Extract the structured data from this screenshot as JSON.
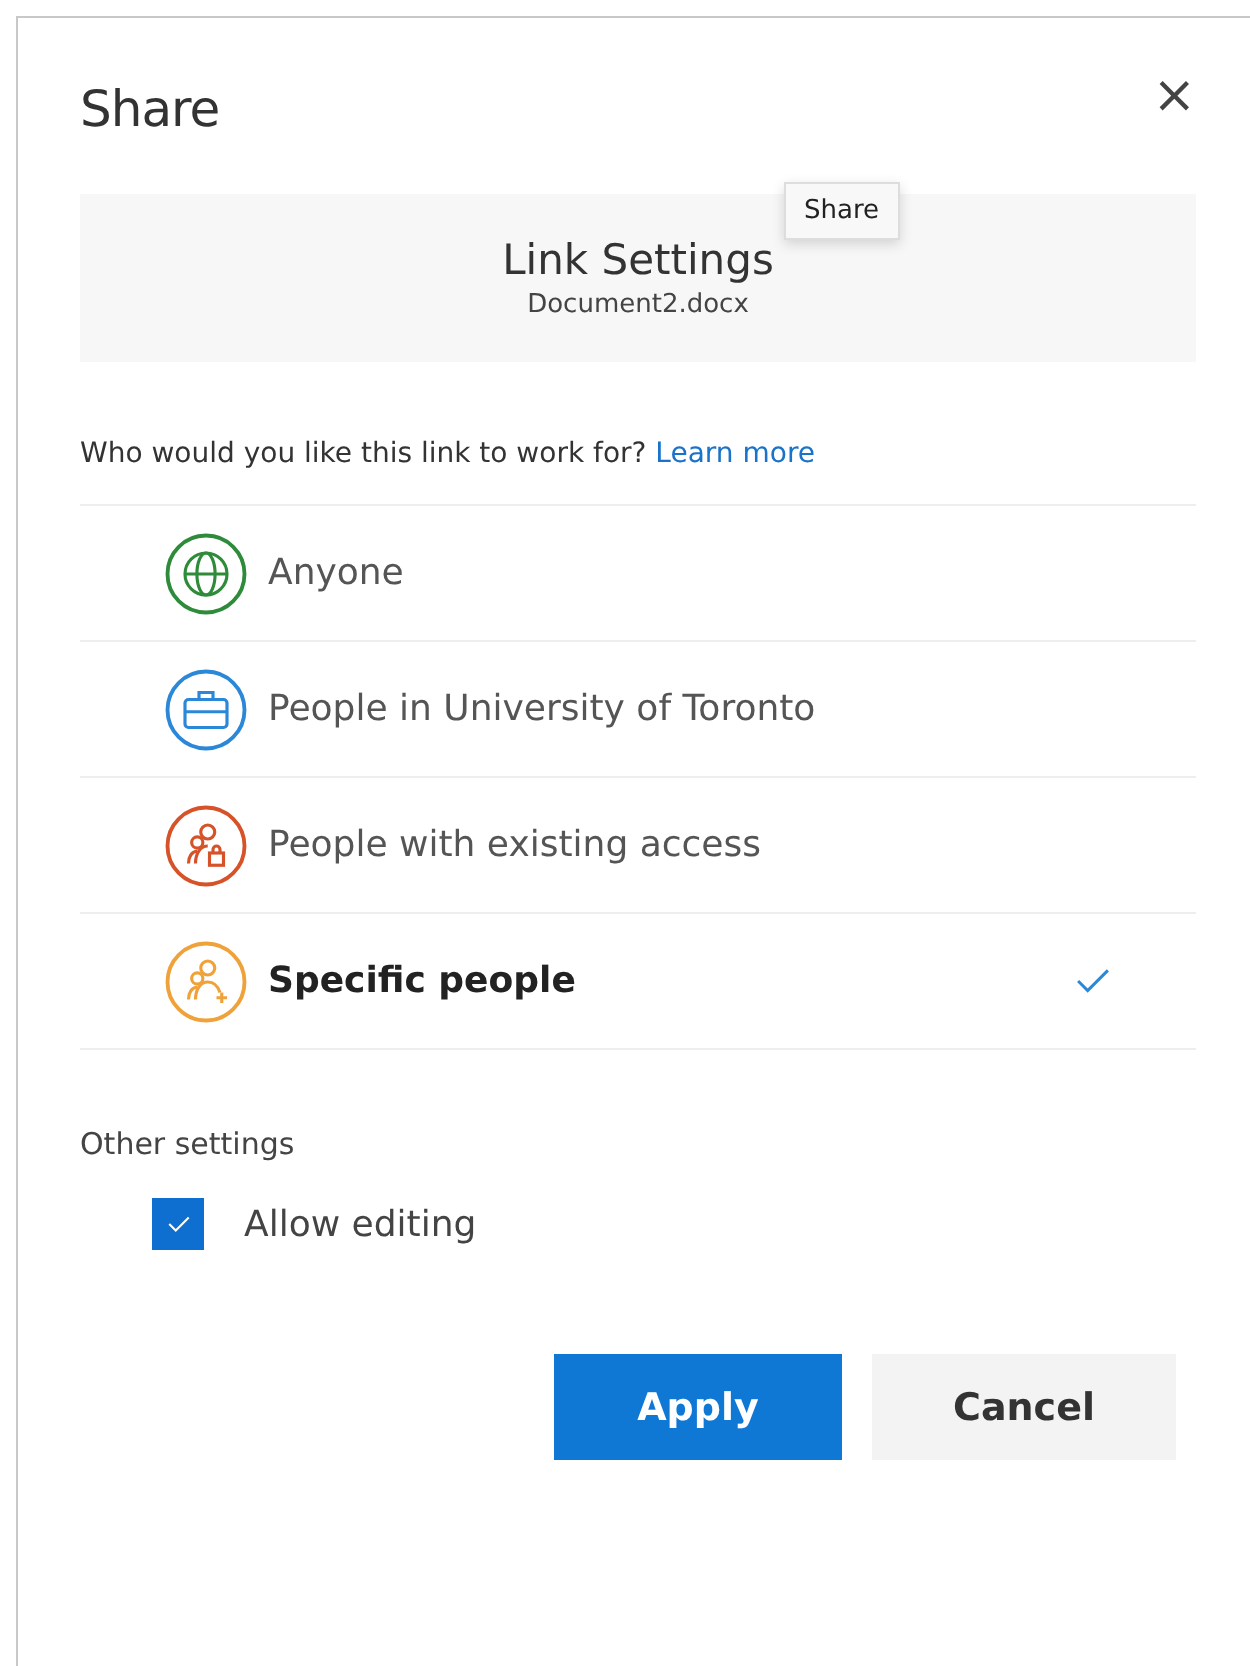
{
  "dialog": {
    "title": "Share",
    "close": "×"
  },
  "tooltip": {
    "text": "Share"
  },
  "header": {
    "title": "Link Settings",
    "filename": "Document2.docx"
  },
  "prompt": {
    "text": "Who would you like this link to work for?",
    "link": "Learn more"
  },
  "options": [
    {
      "label": "Anyone",
      "kind": "globe",
      "color": "#2e8b3a",
      "selected": false
    },
    {
      "label": "People in University of Toronto",
      "kind": "briefcase",
      "color": "#2b88d8",
      "selected": false
    },
    {
      "label": "People with existing access",
      "kind": "people-lock",
      "color": "#d6532a",
      "selected": false
    },
    {
      "label": "Specific people",
      "kind": "people-add",
      "color": "#f0a23a",
      "selected": true
    }
  ],
  "other_settings": {
    "title": "Other settings",
    "items": [
      {
        "label": "Allow editing",
        "checked": true
      }
    ]
  },
  "buttons": [
    {
      "label": "Apply",
      "kind": "primary"
    },
    {
      "label": "Cancel",
      "kind": "secondary"
    }
  ]
}
